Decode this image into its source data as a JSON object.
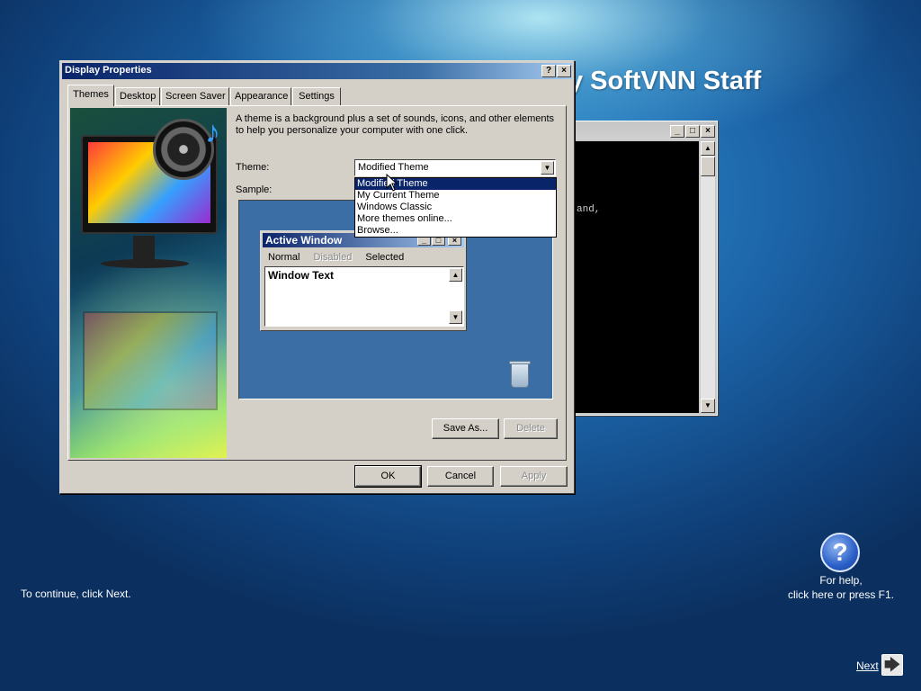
{
  "banner": {
    "text": "y SoftVNN Staff"
  },
  "console": {
    "visible_text": "and,",
    "buttons": {
      "minimize": "_",
      "maximize": "□",
      "close": "×"
    },
    "scroll": {
      "up": "▲",
      "down": "▼"
    }
  },
  "dialog": {
    "title": "Display Properties",
    "title_buttons": {
      "help": "?",
      "close": "×"
    },
    "tabs": [
      {
        "label": "Themes",
        "active": true
      },
      {
        "label": "Desktop",
        "active": false
      },
      {
        "label": "Screen Saver",
        "active": false
      },
      {
        "label": "Appearance",
        "active": false
      },
      {
        "label": "Settings",
        "active": false
      }
    ],
    "description": "A theme is a background plus a set of sounds, icons, and other elements to help you personalize your computer with one click.",
    "theme_label": "Theme:",
    "theme_value": "Modified Theme",
    "combo_arrow": "▼",
    "sample_label": "Sample:",
    "theme_options": [
      {
        "label": "Modified Theme",
        "selected": true
      },
      {
        "label": "My Current Theme",
        "selected": false
      },
      {
        "label": "Windows Classic",
        "selected": false
      },
      {
        "label": "More themes online...",
        "selected": false
      },
      {
        "label": "Browse...",
        "selected": false
      }
    ],
    "preview": {
      "window_title": "Active Window",
      "buttons": {
        "minimize": "_",
        "maximize": "□",
        "close": "×"
      },
      "menu": {
        "normal": "Normal",
        "disabled": "Disabled",
        "selected": "Selected"
      },
      "window_text": "Window Text",
      "scroll": {
        "up": "▲",
        "down": "▼"
      }
    },
    "buttons": {
      "save_as": "Save As...",
      "delete": "Delete",
      "ok": "OK",
      "cancel": "Cancel",
      "apply": "Apply"
    }
  },
  "setup": {
    "continue_text": "To continue, click Next.",
    "help_icon": "?",
    "help_line1": "For help,",
    "help_line2": "click here or press F1.",
    "next_label": "Next",
    "next_arrow": "🡆",
    "colors": {
      "accent_title": "#0a246a",
      "selection": "#0a246a",
      "desktop_sample": "#3a6ea5"
    }
  }
}
